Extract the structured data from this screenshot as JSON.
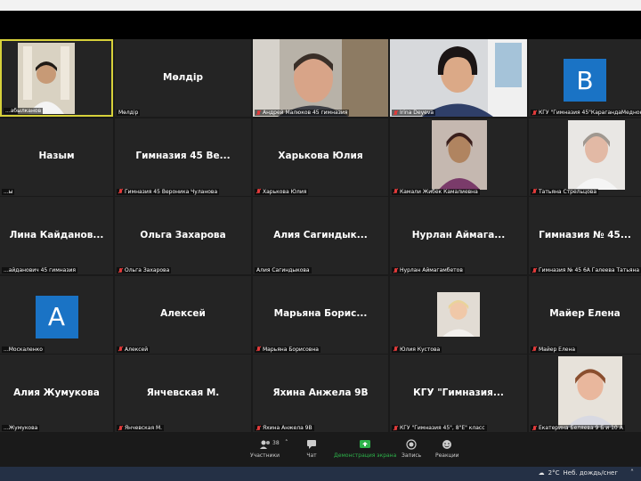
{
  "participants": [
    {
      "id": "t1",
      "center": "",
      "label": "...абылканов",
      "muted": false,
      "type": "video",
      "active": true
    },
    {
      "id": "t2",
      "center": "Мөлдір",
      "label": "Мөлдір",
      "muted": false,
      "type": "name"
    },
    {
      "id": "t3",
      "center": "",
      "label": "Андрей Малюков 45 гимназия",
      "muted": true,
      "type": "video"
    },
    {
      "id": "t4",
      "center": "",
      "label": "Irina Deyeva",
      "muted": true,
      "type": "video"
    },
    {
      "id": "t5",
      "center": "",
      "label": "КГУ \"Гимназия 45\"КарагандаМедноно",
      "muted": true,
      "type": "letter",
      "letter": "В"
    },
    {
      "id": "t6",
      "center": "Назым",
      "label": "...ы",
      "muted": false,
      "type": "name"
    },
    {
      "id": "t7",
      "center": "Гимназия 45 Ве...",
      "label": "Гимназия 45 Вероника Чуланова",
      "muted": true,
      "type": "name"
    },
    {
      "id": "t8",
      "center": "Харькова Юлия",
      "label": "Харькова Юлия",
      "muted": true,
      "type": "name"
    },
    {
      "id": "t9",
      "center": "",
      "label": "Камали Жибек Камалиевна",
      "muted": true,
      "type": "photo"
    },
    {
      "id": "t10",
      "center": "",
      "label": "Татьяна Стрельцова",
      "muted": true,
      "type": "photo"
    },
    {
      "id": "t11",
      "center": "Лина Кайданов...",
      "label": "...айданович 45 гимназия",
      "muted": false,
      "type": "name"
    },
    {
      "id": "t12",
      "center": "Ольга Захарова",
      "label": "Ольга Захарова",
      "muted": true,
      "type": "name"
    },
    {
      "id": "t13",
      "center": "Алия Сагиндык...",
      "label": "Алия Сагиндыкова",
      "muted": false,
      "type": "name"
    },
    {
      "id": "t14",
      "center": "Нурлан Аймага...",
      "label": "Нурлан Аймагамбетов",
      "muted": true,
      "type": "name"
    },
    {
      "id": "t15",
      "center": "Гимназия № 45...",
      "label": "Гимназия № 45 6А Галеева Татьяна",
      "muted": true,
      "type": "name"
    },
    {
      "id": "t16",
      "center": "",
      "label": "...Москаленко",
      "muted": false,
      "type": "letter",
      "letter": "А"
    },
    {
      "id": "t17",
      "center": "Алексей",
      "label": "Алексей",
      "muted": true,
      "type": "name"
    },
    {
      "id": "t18",
      "center": "Марьяна Борис...",
      "label": "Марьяна Борисовна",
      "muted": true,
      "type": "name"
    },
    {
      "id": "t19",
      "center": "",
      "label": "Юлия Кустова",
      "muted": true,
      "type": "photo"
    },
    {
      "id": "t20",
      "center": "Майер Елена",
      "label": "Майер Елена",
      "muted": true,
      "type": "name"
    },
    {
      "id": "t21",
      "center": "Алия Жумукова",
      "label": "...Жумукова",
      "muted": false,
      "type": "name"
    },
    {
      "id": "t22",
      "center": "Янчевская М.",
      "label": "Янчевская М.",
      "muted": true,
      "type": "name"
    },
    {
      "id": "t23",
      "center": "Яхина Анжела 9В",
      "label": "Яхина Анжела 9В",
      "muted": true,
      "type": "name"
    },
    {
      "id": "t24",
      "center": "КГУ \"Гимназия...",
      "label": "КГУ \"Гимназия 45\", 8\"Е\" класс",
      "muted": true,
      "type": "name"
    },
    {
      "id": "t25",
      "center": "",
      "label": "Екатерина Беляева 9 Б и 10 А",
      "muted": true,
      "type": "photo"
    }
  ],
  "toolbar": {
    "participants_label": "Участники",
    "participants_count": "38",
    "chat_label": "Чат",
    "share_label": "Демонстрация экрана",
    "record_label": "Запись",
    "reactions_label": "Реакции"
  },
  "taskbar": {
    "temperature": "2°C",
    "weather_text": "Неб. дождь/снег"
  },
  "colors": {
    "active_border": "#d7d13a",
    "share_green": "#2db24a",
    "letter_tile": "#1a73c5",
    "mic_muted": "#e23b3b"
  }
}
